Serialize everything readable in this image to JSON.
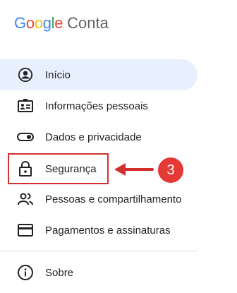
{
  "header": {
    "logo_letters": [
      {
        "ch": "G",
        "color": "#4285F4"
      },
      {
        "ch": "o",
        "color": "#EA4335"
      },
      {
        "ch": "o",
        "color": "#FBBC05"
      },
      {
        "ch": "g",
        "color": "#4285F4"
      },
      {
        "ch": "l",
        "color": "#34A853"
      },
      {
        "ch": "e",
        "color": "#EA4335"
      }
    ],
    "product": "Conta"
  },
  "nav": {
    "items": [
      {
        "label": "Início",
        "icon": "account-circle-icon",
        "active": true
      },
      {
        "label": "Informações pessoais",
        "icon": "id-card-icon"
      },
      {
        "label": "Dados e privacidade",
        "icon": "toggle-icon"
      },
      {
        "label": "Segurança",
        "icon": "lock-icon"
      },
      {
        "label": "Pessoas e compartilhamento",
        "icon": "people-icon"
      },
      {
        "label": "Pagamentos e assinaturas",
        "icon": "credit-card-icon"
      },
      {
        "label": "Sobre",
        "icon": "info-icon"
      }
    ]
  },
  "annotation": {
    "step": "3",
    "color": "#d32f2f"
  },
  "colors": {
    "active_bg": "#e8f0fe",
    "icon": "#202124"
  }
}
